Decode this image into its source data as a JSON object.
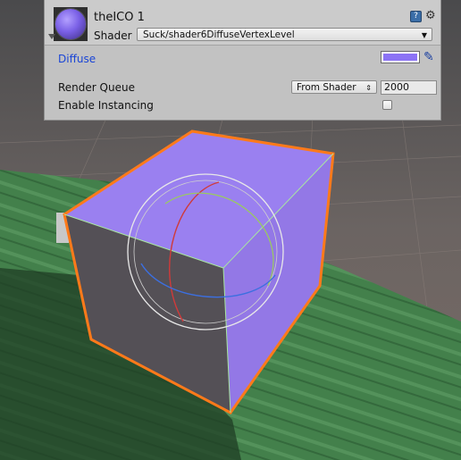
{
  "material": {
    "name": "theICO 1",
    "shader_label": "Shader",
    "shader_value": "Suck/shader6DiffuseVertexLevel"
  },
  "properties": {
    "diffuse_label": "Diffuse",
    "diffuse_color": "#8c73f5",
    "render_queue_label": "Render Queue",
    "render_queue_mode": "From Shader",
    "render_queue_value": "2000",
    "enable_instancing_label": "Enable Instancing",
    "enable_instancing_checked": false
  },
  "icons": {
    "help": "help-icon",
    "settings": "gear-icon",
    "color_picker": "eyedropper-icon",
    "foldout": "triangle-down-icon",
    "dropdown": "chevron-down-icon"
  },
  "scene": {
    "cube_color": "#9c7ef0",
    "selection_outline_color": "#ff7a1a",
    "ground_color": "#3e7a45"
  }
}
